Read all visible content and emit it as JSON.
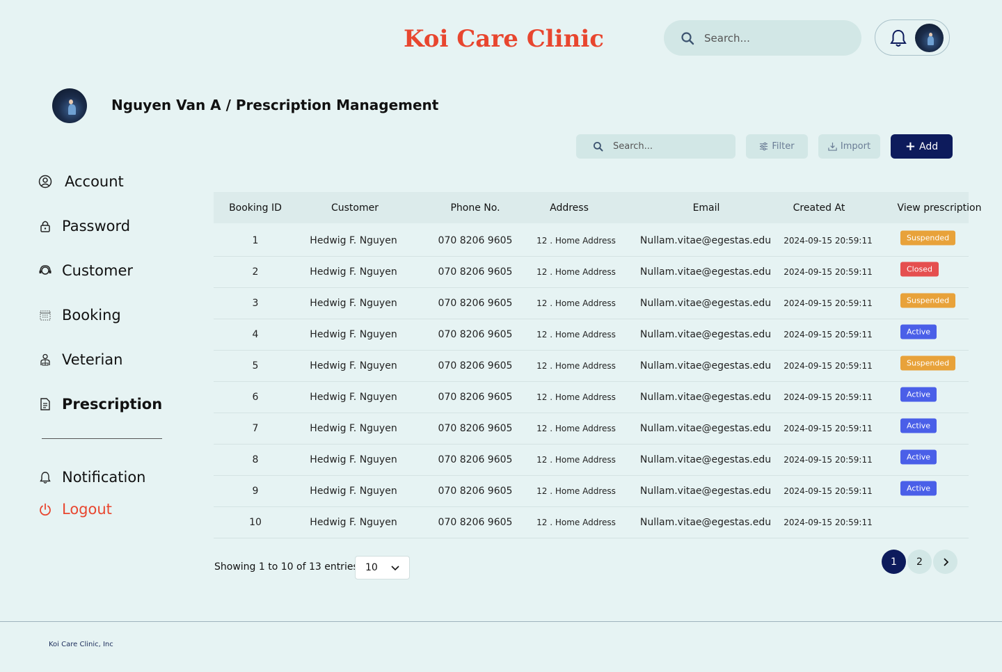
{
  "header": {
    "brand": "Koi Care Clinic",
    "search_placeholder": "Search..."
  },
  "page": {
    "title": "Nguyen Van A / Prescription Management"
  },
  "sidebar": {
    "items": [
      {
        "label": "Account",
        "icon": "user-circle-icon"
      },
      {
        "label": "Password",
        "icon": "lock-icon"
      },
      {
        "label": "Customer",
        "icon": "headset-icon"
      },
      {
        "label": "Booking",
        "icon": "calendar-icon"
      },
      {
        "label": "Veterian",
        "icon": "doctor-icon"
      },
      {
        "label": "Prescription",
        "icon": "document-icon",
        "active": true
      }
    ],
    "notification": "Notification",
    "logout": "Logout"
  },
  "toolbar": {
    "search_placeholder": "Search...",
    "filter": "Filter",
    "import": "Import",
    "add": "Add"
  },
  "table": {
    "columns": [
      "Booking ID",
      "Customer",
      "Phone No.",
      "Address",
      "Email",
      "Created At",
      "View prescription"
    ],
    "rows": [
      {
        "id": "1",
        "customer": "Hedwig F. Nguyen",
        "phone": "070 8206 9605",
        "address": "12 . Home Address",
        "email": "Nullam.vitae@egestas.edu",
        "created": "2024-09-15 20:59:11",
        "status": "Suspended"
      },
      {
        "id": "2",
        "customer": "Hedwig F. Nguyen",
        "phone": "070 8206 9605",
        "address": "12 . Home Address",
        "email": "Nullam.vitae@egestas.edu",
        "created": "2024-09-15 20:59:11",
        "status": "Closed"
      },
      {
        "id": "3",
        "customer": "Hedwig F. Nguyen",
        "phone": "070 8206 9605",
        "address": "12 . Home Address",
        "email": "Nullam.vitae@egestas.edu",
        "created": "2024-09-15 20:59:11",
        "status": "Suspended"
      },
      {
        "id": "4",
        "customer": "Hedwig F. Nguyen",
        "phone": "070 8206 9605",
        "address": "12 . Home Address",
        "email": "Nullam.vitae@egestas.edu",
        "created": "2024-09-15 20:59:11",
        "status": "Active"
      },
      {
        "id": "5",
        "customer": "Hedwig F. Nguyen",
        "phone": "070 8206 9605",
        "address": "12 . Home Address",
        "email": "Nullam.vitae@egestas.edu",
        "created": "2024-09-15 20:59:11",
        "status": "Suspended"
      },
      {
        "id": "6",
        "customer": "Hedwig F. Nguyen",
        "phone": "070 8206 9605",
        "address": "12 . Home Address",
        "email": "Nullam.vitae@egestas.edu",
        "created": "2024-09-15 20:59:11",
        "status": "Active"
      },
      {
        "id": "7",
        "customer": "Hedwig F. Nguyen",
        "phone": "070 8206 9605",
        "address": "12 . Home Address",
        "email": "Nullam.vitae@egestas.edu",
        "created": "2024-09-15 20:59:11",
        "status": "Active"
      },
      {
        "id": "8",
        "customer": "Hedwig F. Nguyen",
        "phone": "070 8206 9605",
        "address": "12 . Home Address",
        "email": "Nullam.vitae@egestas.edu",
        "created": "2024-09-15 20:59:11",
        "status": "Active"
      },
      {
        "id": "9",
        "customer": "Hedwig F. Nguyen",
        "phone": "070 8206 9605",
        "address": "12 . Home Address",
        "email": "Nullam.vitae@egestas.edu",
        "created": "2024-09-15 20:59:11",
        "status": "Active"
      },
      {
        "id": "10",
        "customer": "Hedwig F. Nguyen",
        "phone": "070 8206 9605",
        "address": "12 . Home Address",
        "email": "Nullam.vitae@egestas.edu",
        "created": "2024-09-15 20:59:11",
        "status": ""
      }
    ],
    "status_colors": {
      "Suspended": "#e8a23a",
      "Closed": "#e54f4f",
      "Active": "#4a5fe8"
    }
  },
  "pagination": {
    "showing": "Showing 1 to 10 of 13 entries",
    "page_size": "10",
    "pages": [
      "1",
      "2"
    ],
    "current_page": "1"
  },
  "footer": {
    "copyright": "Koi Care Clinic, Inc"
  },
  "colors": {
    "brand": "#e8462f",
    "primary": "#0d1b5c",
    "background": "#e6f3f3"
  }
}
